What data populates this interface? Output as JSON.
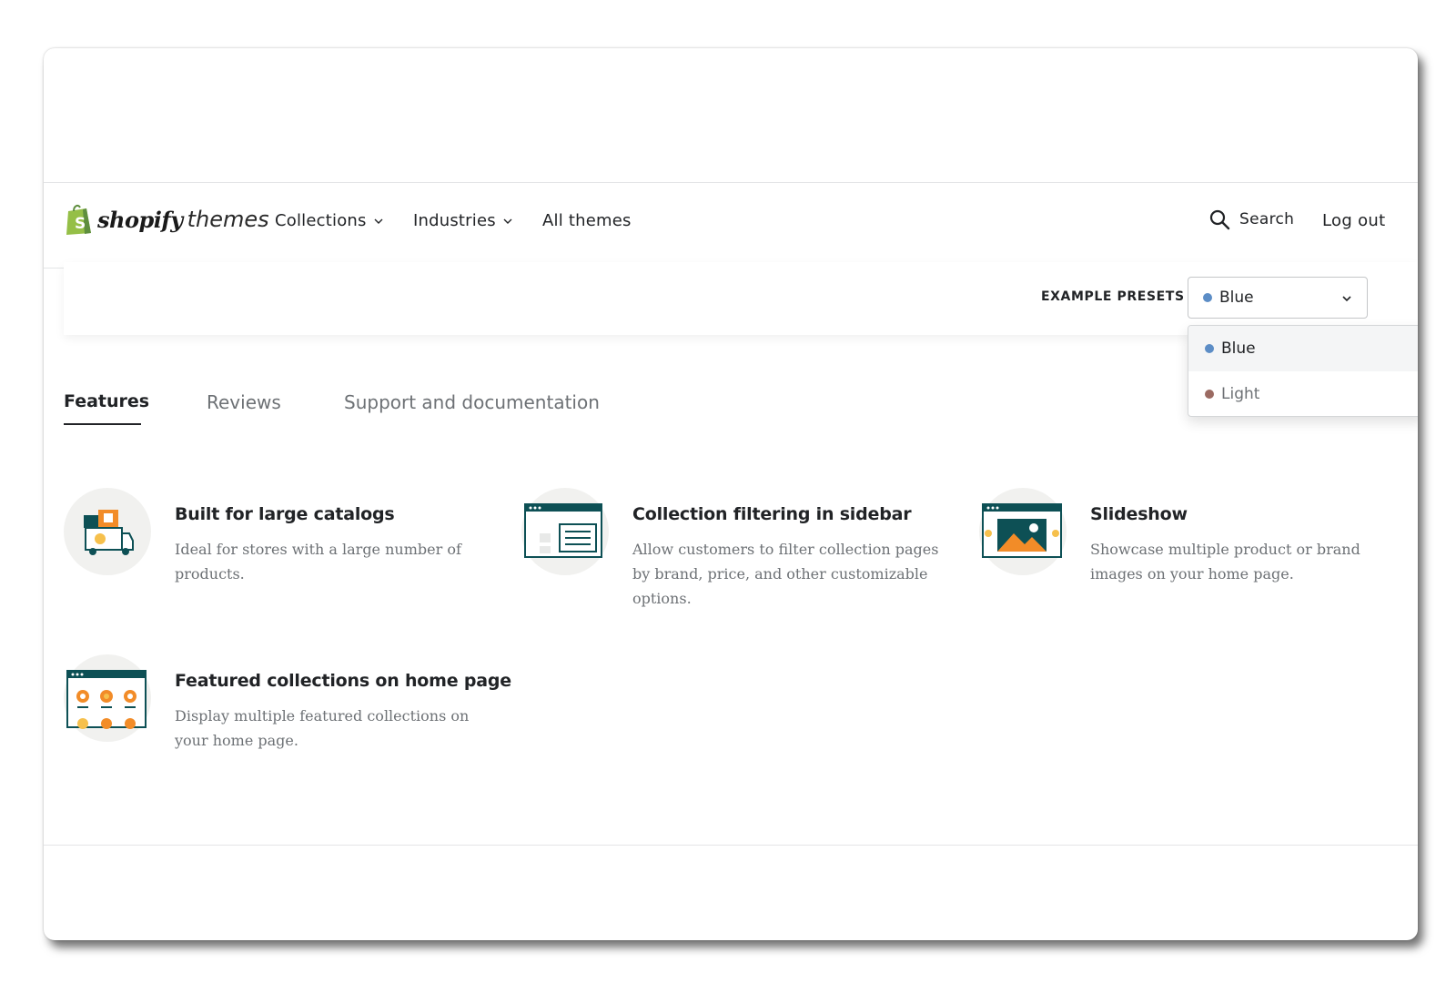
{
  "logo": {
    "primary": "shopify",
    "secondary": "themes"
  },
  "nav": {
    "items": [
      {
        "label": "Collections",
        "has_dropdown": true
      },
      {
        "label": "Industries",
        "has_dropdown": true
      },
      {
        "label": "All themes",
        "has_dropdown": false
      }
    ],
    "search_label": "Search",
    "logout_label": "Log out"
  },
  "presets": {
    "label": "EXAMPLE PRESETS",
    "selected": "Blue",
    "selected_color": "#5c8dc6",
    "options": [
      {
        "label": "Blue",
        "color": "#5c8dc6"
      },
      {
        "label": "Light",
        "color": "#9b6a62"
      }
    ]
  },
  "tabs": [
    {
      "label": "Features",
      "active": true
    },
    {
      "label": "Reviews",
      "active": false
    },
    {
      "label": "Support and documentation",
      "active": false
    }
  ],
  "features": [
    {
      "title": "Built for large catalogs",
      "description": "Ideal for stores with a large number of products.",
      "icon": "delivery-truck-icon"
    },
    {
      "title": "Collection filtering in sidebar",
      "description": "Allow customers to filter collection pages by brand, price, and other customizable options.",
      "icon": "filter-sidebar-icon"
    },
    {
      "title": "Slideshow",
      "description": "Showcase multiple product or brand images on your home page.",
      "icon": "slideshow-icon"
    },
    {
      "title": "Featured collections on home page",
      "description": "Display multiple featured collections on your home page.",
      "icon": "featured-collections-icon"
    }
  ],
  "colors": {
    "text": "#212326",
    "muted": "#6d7175",
    "brand_green": "#95bf47",
    "icon_teal": "#0d5055",
    "icon_orange": "#f28c28"
  }
}
